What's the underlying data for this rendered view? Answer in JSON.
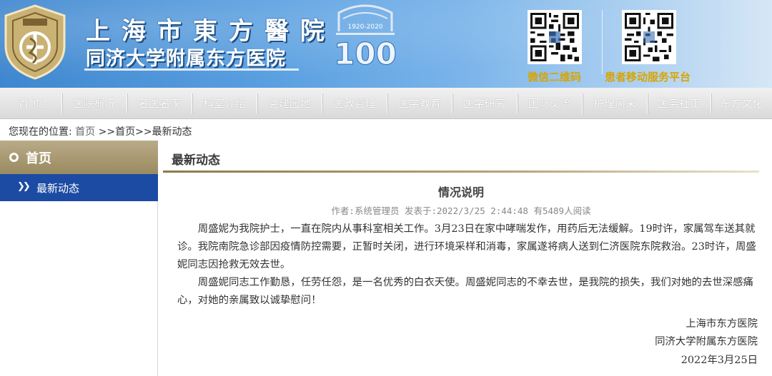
{
  "header": {
    "name_cn": "上海市東方醫院",
    "name_sub": "同济大学附属东方医院",
    "anniversary_years": "1920-2020",
    "anniversary_number": "100",
    "qr_wechat_label": "微信二维码",
    "qr_mobile_label": "患者移动服务平台"
  },
  "nav": {
    "items": [
      "首 页",
      "医院概况",
      "名医名家",
      "科室介绍",
      "党建园地",
      "医政管理",
      "医学教育",
      "医学研究",
      "国际交流",
      "护理风采",
      "医务社工",
      "东方文化"
    ]
  },
  "breadcrumb": {
    "prefix": "您现在的位置:",
    "home": "首页",
    "rest": ">>首页>>最新动态"
  },
  "sidebar": {
    "title": "首页",
    "items": [
      {
        "label": "最新动态"
      }
    ]
  },
  "main": {
    "section_title": "最新动态",
    "article": {
      "title": "情况说明",
      "meta": "作者:系统管理员 发表于:2022/3/25 2:44:48 有5489人阅读",
      "paragraphs": [
        "周盛妮为我院护士，一直在院内从事科室相关工作。3月23日在家中哮喘发作，用药后无法缓解。19时许，家属驾车送其就诊。我院南院急诊部因疫情防控需要，正暂时关闭，进行环境采样和消毒，家属遂将病人送到仁济医院东院救治。23时许，周盛妮同志因抢救无效去世。",
        "周盛妮同志工作勤恳，任劳任怨，是一名优秀的白衣天使。周盛妮同志的不幸去世，是我院的损失，我们对她的去世深感痛心，对她的亲属致以诚挚慰问！"
      ],
      "signature": [
        "上海市东方医院",
        "同济大学附属东方医院",
        "2022年3月25日"
      ]
    }
  },
  "colors": {
    "header_blue": "#4a90d9",
    "qr_label_gold": "#d9a400",
    "sidebar_head": "#a89a6e",
    "sidebar_active": "#1c4ba3",
    "rule_gold": "#8c7a4a"
  }
}
